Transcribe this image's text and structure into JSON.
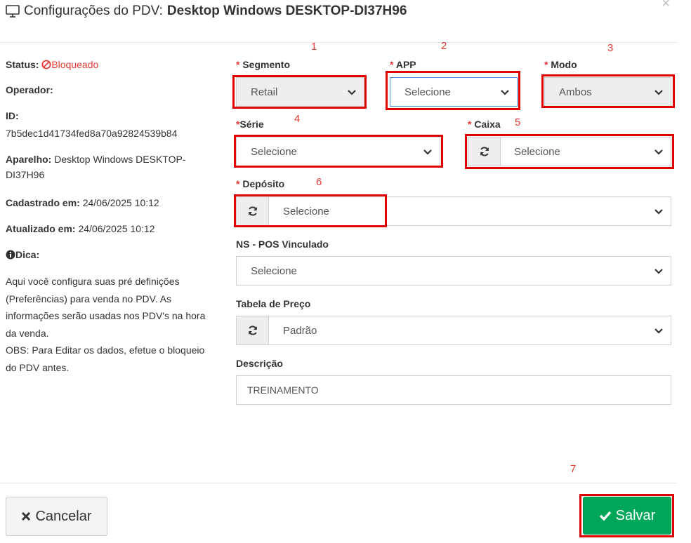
{
  "header": {
    "title_prefix": "Configurações do PDV:",
    "title_device": "Desktop Windows DESKTOP-DI37H96"
  },
  "sidebar": {
    "status_label": "Status:",
    "status_value": "Bloqueado",
    "operator_label": "Operador:",
    "id_label": "ID:",
    "id_value": "7b5dec1d41734fed8a70a92824539b84",
    "device_label": "Aparelho:",
    "device_value": "Desktop Windows DESKTOP-DI37H96",
    "created_label": "Cadastrado em:",
    "created_value": "24/06/2025 10:12",
    "updated_label": "Atualizado em:",
    "updated_value": "24/06/2025 10:12",
    "tip_label": "Dica:",
    "tip_text": "Aqui você configura suas pré definições (Preferências) para venda no PDV. As informações serão usadas nos PDV's na hora da venda.",
    "tip_obs": "OBS: Para Editar os dados, efetue o bloqueio do PDV antes."
  },
  "form": {
    "segmento": {
      "required": "*",
      "label": "Segmento",
      "value": "Retail"
    },
    "app": {
      "required": "*",
      "label": "APP",
      "value": "Selecione"
    },
    "modo": {
      "required": "*",
      "label": "Modo",
      "value": "Ambos"
    },
    "serie": {
      "required": "*",
      "label": "Série",
      "value": "Selecione"
    },
    "caixa": {
      "required": "*",
      "label": "Caixa",
      "value": "Selecione"
    },
    "deposito": {
      "required": "*",
      "label": "Depósito",
      "value": "Selecione"
    },
    "ns_pos": {
      "label": "NS - POS Vinculado",
      "value": "Selecione"
    },
    "tabela": {
      "label": "Tabela de Preço",
      "value": "Padrão"
    },
    "descricao": {
      "label": "Descrição",
      "value": "TREINAMENTO"
    }
  },
  "annotations": [
    "1",
    "2",
    "3",
    "4",
    "5",
    "6",
    "7"
  ],
  "footer": {
    "cancel_label": "Cancelar",
    "save_label": "Salvar"
  },
  "colors": {
    "required": "#e53935",
    "highlight": "#e00000",
    "save_button": "#00a65a",
    "select_border": "#d0d0d0"
  },
  "icons": {
    "title": "monitor-icon",
    "close": "close-icon",
    "status": "ban-icon",
    "tip": "info-icon",
    "refresh": "refresh-icon",
    "select": "chevron-down-icon",
    "cancel": "times-icon",
    "save": "check-icon"
  }
}
